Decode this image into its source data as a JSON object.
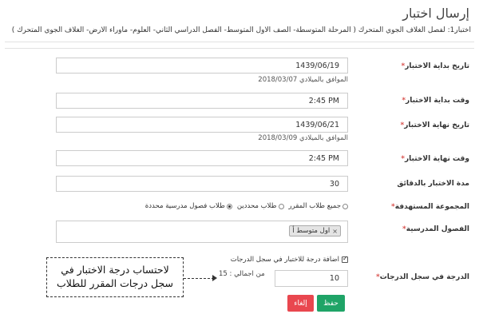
{
  "page": {
    "title": "إرسال اختبار",
    "test_description": "اختبار1: لفصل الغلاف الجوي المتحرك ( المرحلة المتوسطة- الصف الأول المتوسط- الفصل الدراسي الثاني- العلوم- ماوراء الأرض- الغلاف الجوي المتحرك )"
  },
  "form": {
    "start_date": {
      "label": "تاريخ بداية الاختبار",
      "value": "1439/06/19",
      "gregorian": "الموافق بالميلادي 2018/03/07"
    },
    "start_time": {
      "label": "وقت بداية الاختبار",
      "value": "2:45 PM"
    },
    "end_date": {
      "label": "تاريخ نهاية الاختبار",
      "value": "1439/06/21",
      "gregorian": "الموافق بالميلادي 2018/03/09"
    },
    "end_time": {
      "label": "وقت نهاية الاختبار",
      "value": "2:45 PM"
    },
    "duration": {
      "label": "مدة الاختبار بالدقائق",
      "value": "30"
    },
    "target_group": {
      "label": "المجموعة المستهدفة",
      "options": [
        "جميع طلاب المقرر",
        "طلاب محددين",
        "طلاب فصول مدرسية محددة"
      ],
      "selected_index": 2
    },
    "classes": {
      "label": "الفصول المدرسية",
      "tag": "اول متوسط أ",
      "tag_remove": "×"
    },
    "add_grade": {
      "label": "اضافة درجة للاختبار في سجل الدرجات",
      "checked": true
    },
    "grade": {
      "label": "الدرجة في سجل الدرجات",
      "value": "10",
      "total_text": "من اجمالي : 15"
    },
    "required_mark": "*"
  },
  "callout": {
    "line1": "لاحتساب درجة الاختبار في",
    "line2": "سجل درجات المقرر للطلاب"
  },
  "buttons": {
    "save": "حفظ",
    "cancel": "إلغاء"
  },
  "colors": {
    "save": "#1fa467",
    "cancel": "#e9474f",
    "required": "#d9534f"
  }
}
